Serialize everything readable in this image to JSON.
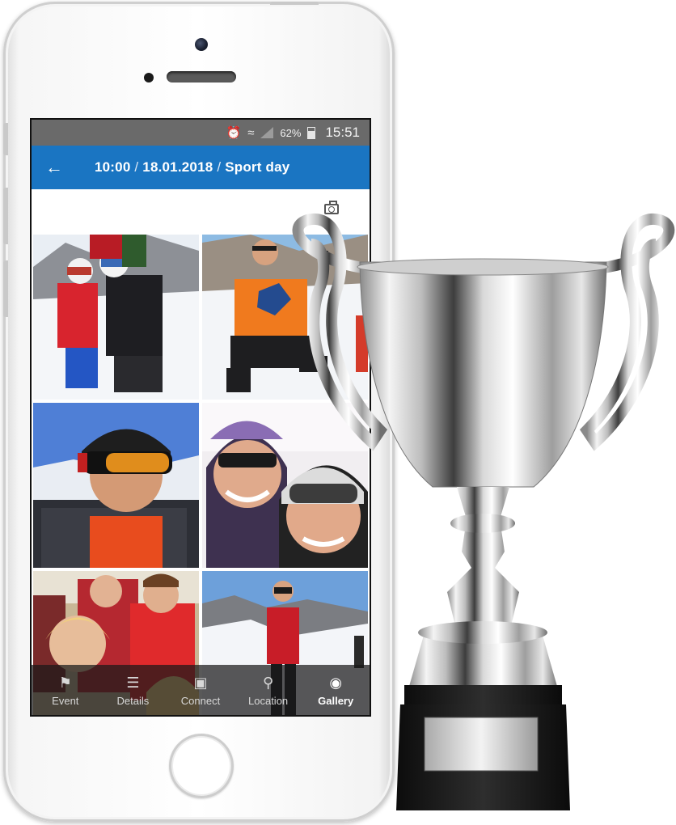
{
  "status_bar": {
    "battery": "62%",
    "time": "15:51",
    "icons": [
      "alarm-icon",
      "wifi-icon",
      "signal-icon",
      "battery-icon"
    ]
  },
  "app_bar": {
    "back_icon": "arrow-left-icon",
    "time": "10:00",
    "separator": "/",
    "date": "18.01.2018",
    "event": "Sport day"
  },
  "gallery": {
    "camera_icon": "camera-icon",
    "photos": [
      "ski-photo-1",
      "ski-photo-2",
      "ski-photo-3",
      "ski-photo-4",
      "ski-photo-5",
      "ski-photo-6"
    ]
  },
  "bottom_nav": {
    "items": [
      {
        "label": "Event",
        "icon": "flag-icon"
      },
      {
        "label": "Details",
        "icon": "list-icon"
      },
      {
        "label": "Connect",
        "icon": "chat-icon"
      },
      {
        "label": "Location",
        "icon": "location-pin-icon"
      },
      {
        "label": "Gallery",
        "icon": "camera-icon"
      }
    ],
    "active": "Gallery"
  },
  "colors": {
    "app_bar": "#1a75c2",
    "status_bar": "#6a6a6a",
    "nav_bg": "#191919"
  }
}
